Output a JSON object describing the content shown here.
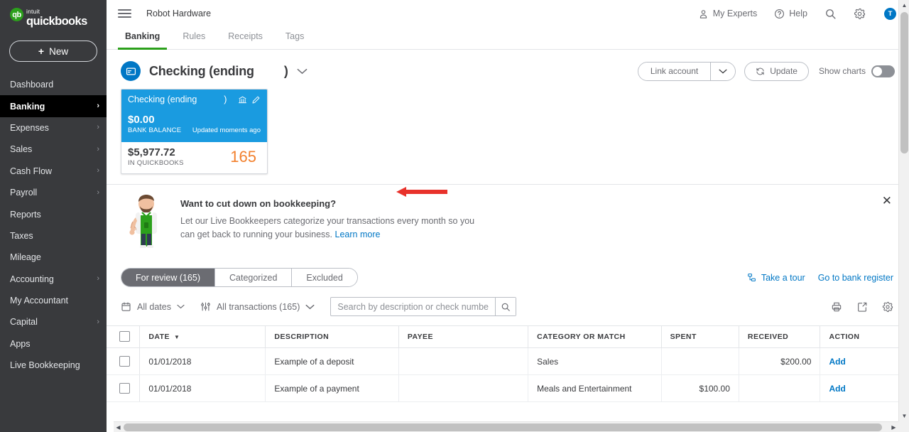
{
  "brand": {
    "intuit": "intuit",
    "name": "quickbooks",
    "mark": "qb"
  },
  "sidebar": {
    "new_button": "New",
    "plus": "+",
    "items": [
      {
        "label": "Dashboard",
        "chevron": ""
      },
      {
        "label": "Banking",
        "chevron": "›"
      },
      {
        "label": "Expenses",
        "chevron": "›"
      },
      {
        "label": "Sales",
        "chevron": "›"
      },
      {
        "label": "Cash Flow",
        "chevron": "›"
      },
      {
        "label": "Payroll",
        "chevron": "›"
      },
      {
        "label": "Reports",
        "chevron": ""
      },
      {
        "label": "Taxes",
        "chevron": ""
      },
      {
        "label": "Mileage",
        "chevron": ""
      },
      {
        "label": "Accounting",
        "chevron": "›"
      },
      {
        "label": "My Accountant",
        "chevron": ""
      },
      {
        "label": "Capital",
        "chevron": "›"
      },
      {
        "label": "Apps",
        "chevron": ""
      },
      {
        "label": "Live Bookkeeping",
        "chevron": ""
      }
    ]
  },
  "header": {
    "company": "Robot Hardware",
    "my_experts": "My Experts",
    "help": "Help",
    "avatar_initial": "T"
  },
  "tabs": [
    {
      "label": "Banking",
      "active": true
    },
    {
      "label": "Rules",
      "active": false
    },
    {
      "label": "Receipts",
      "active": false
    },
    {
      "label": "Tags",
      "active": false
    }
  ],
  "account": {
    "title_prefix": "Checking (ending",
    "title_suffix": ")",
    "chevron": "⌄",
    "link_account": "Link account",
    "link_caret": "⌄",
    "update": "Update",
    "show_charts": "Show charts",
    "toggle_on": false
  },
  "card": {
    "name_prefix": "Checking (ending",
    "name_suffix": ")",
    "bank_balance": "$0.00",
    "bank_balance_label": "BANK BALANCE",
    "updated": "Updated moments ago",
    "qb_balance": "$5,977.72",
    "qb_balance_label": "IN QUICKBOOKS",
    "count": "165"
  },
  "banner": {
    "title": "Want to cut down on bookkeeping?",
    "text": "Let our Live Bookkeepers categorize your transactions every month so you can get back to running your business.",
    "link": "Learn more",
    "close": "✕"
  },
  "review": {
    "segments": [
      {
        "label": "For review (165)",
        "active": true
      },
      {
        "label": "Categorized",
        "active": false
      },
      {
        "label": "Excluded",
        "active": false
      }
    ],
    "take_a_tour": "Take a tour",
    "go_to_register": "Go to bank register"
  },
  "filters": {
    "dates": "All dates",
    "transactions": "All transactions (165)",
    "chevron": "⌄",
    "search_placeholder": "Search by description or check number"
  },
  "table": {
    "columns": [
      "DATE",
      "DESCRIPTION",
      "PAYEE",
      "CATEGORY OR MATCH",
      "SPENT",
      "RECEIVED",
      "ACTION"
    ],
    "sort_indicator": "▼",
    "rows": [
      {
        "date": "01/01/2018",
        "description": "Example of a deposit",
        "payee": "",
        "category": "Sales",
        "spent": "",
        "received": "$200.00",
        "action": "Add"
      },
      {
        "date": "01/01/2018",
        "description": "Example of a payment",
        "payee": "",
        "category": "Meals and Entertainment",
        "spent": "$100.00",
        "received": "",
        "action": "Add"
      }
    ]
  },
  "colors": {
    "brand_green": "#2ca01c",
    "accent_blue": "#0077c5",
    "card_blue": "#1a9be0",
    "count_orange": "#f2802d",
    "sidebar_dark": "#393a3d",
    "annotation_red": "#e8322b"
  },
  "scroll": {
    "up_arrow": "▲",
    "down_arrow": "▼",
    "left_arrow": "◀",
    "right_arrow": "▶",
    "inner_up": "⌃",
    "collapse": "‹"
  }
}
